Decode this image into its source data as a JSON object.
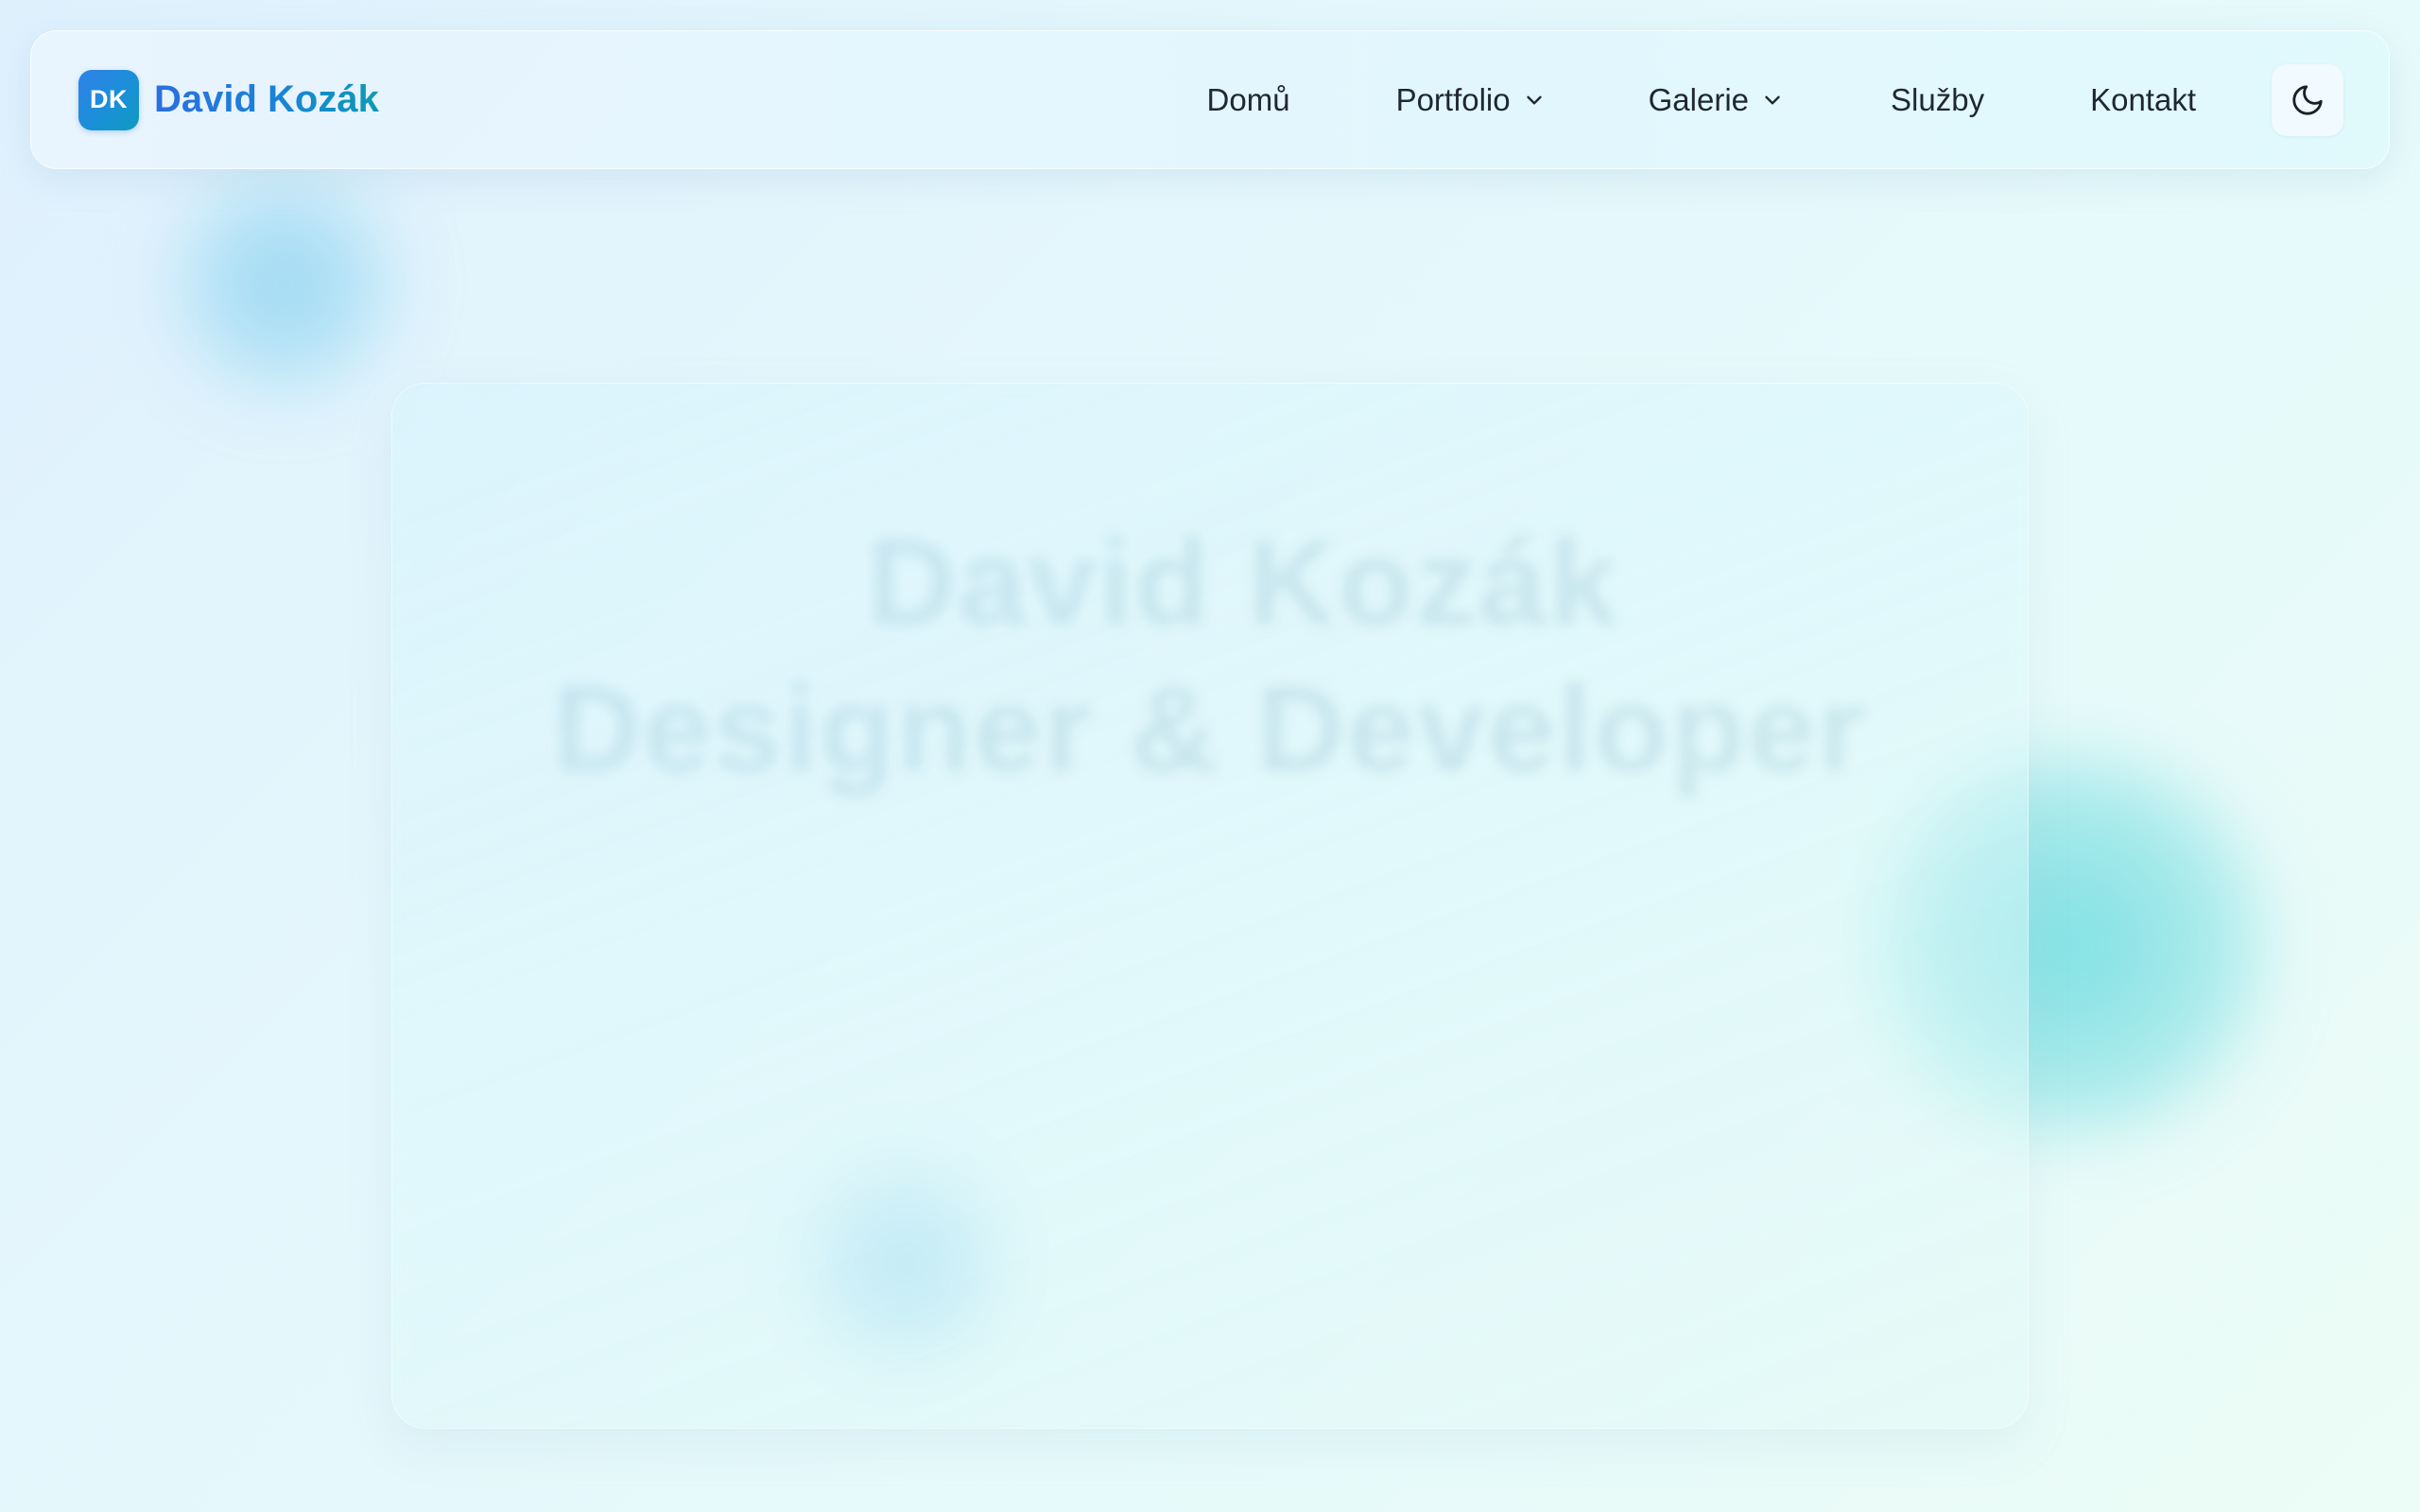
{
  "brand": {
    "logo_text": "DK",
    "name": "David Kozák"
  },
  "nav": {
    "items": [
      {
        "label": "Domů"
      },
      {
        "label": "Portfolio",
        "has_dropdown": true
      },
      {
        "label": "Galerie",
        "has_dropdown": true
      },
      {
        "label": "Služby"
      },
      {
        "label": "Kontakt"
      }
    ],
    "theme_toggle_icon": "moon-icon",
    "dropdown_icon": "chevron-down-icon"
  },
  "hero": {
    "line_1": "David Kozák",
    "line_2": "Designer & Developer"
  },
  "colors": {
    "brand_gradient_start": "#2b6fe0",
    "brand_gradient_end": "#0e99b6",
    "nav_text": "#1f2733"
  }
}
